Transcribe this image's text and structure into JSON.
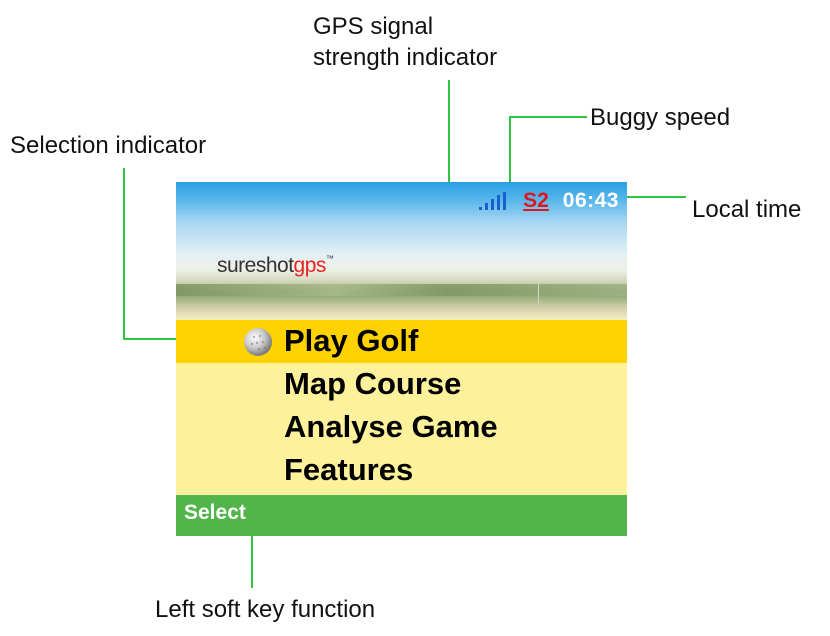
{
  "callouts": {
    "gps_signal_line1": "GPS signal",
    "gps_signal_line2": "strength indicator",
    "buggy_speed": "Buggy speed",
    "selection_indicator": "Selection indicator",
    "local_time": "Local time",
    "left_soft_key": "Left soft key function"
  },
  "status_bar": {
    "signal_icon": "signal-bars-icon",
    "signal_bars": 4,
    "buggy_speed": "S2",
    "local_time": "06:43"
  },
  "branding": {
    "logo_main": "sureshot",
    "logo_accent": "gps",
    "logo_tm": "™"
  },
  "menu": {
    "selected_index": 0,
    "selection_icon": "golf-ball-icon",
    "items": [
      {
        "label": "Play Golf"
      },
      {
        "label": "Map Course"
      },
      {
        "label": "Analyse Game"
      },
      {
        "label": "Features"
      }
    ]
  },
  "soft_keys": {
    "left_label": "Select"
  },
  "colors": {
    "leader_line": "#2fc43f",
    "sky_top": "#2a9fe3",
    "menu_background": "#fdf29b",
    "selection_highlight": "#ffd200",
    "soft_key_bar": "#52b54a",
    "speed_text": "#e2141c",
    "signal_bars": "#1a5fd0"
  }
}
